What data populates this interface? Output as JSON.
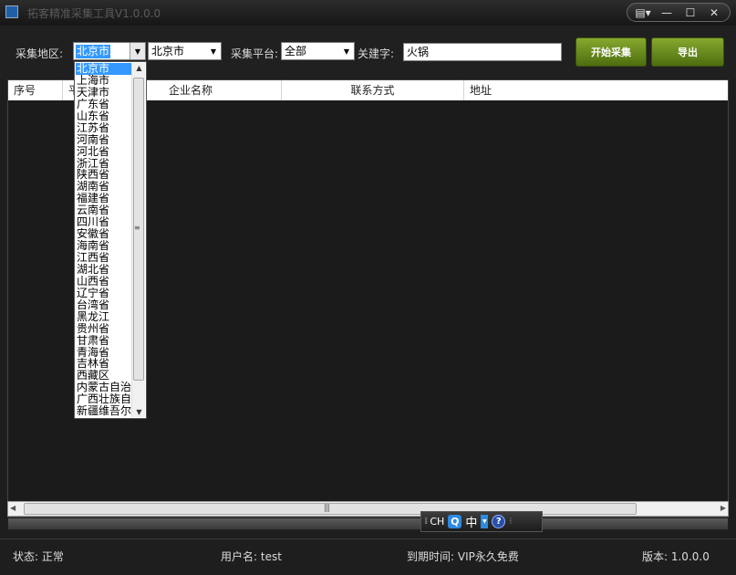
{
  "window": {
    "title": "拓客精准采集工具V1.0.0.0",
    "menu_icon": "menu-dropdown-icon",
    "min_icon": "minimize-icon",
    "max_icon": "maximize-icon",
    "close_icon": "close-icon"
  },
  "toolbar": {
    "region_label": "采集地区:",
    "province_value": "北京市",
    "city_value": "北京市",
    "platform_label": "采集平台:",
    "platform_value": "全部",
    "keyword_label": "关建字:",
    "keyword_value": "火锅",
    "start_button": "开始采集",
    "export_button": "导出"
  },
  "grid": {
    "columns": [
      "序号",
      "平",
      "企业名称",
      "联系方式",
      "地址"
    ]
  },
  "province_dropdown": {
    "selected_index": 0,
    "items": [
      "北京市",
      "上海市",
      "天津市",
      "广东省",
      "山东省",
      "江苏省",
      "河南省",
      "河北省",
      "浙江省",
      "陕西省",
      "湖南省",
      "福建省",
      "云南省",
      "四川省",
      "安徽省",
      "海南省",
      "江西省",
      "湖北省",
      "山西省",
      "辽宁省",
      "台湾省",
      "黑龙江",
      "贵州省",
      "甘肃省",
      "青海省",
      "吉林省",
      "西藏区",
      "内蒙古自治",
      "广西壮族自",
      "新疆维吾尔"
    ]
  },
  "ime": {
    "lang": "CH",
    "mode": "中",
    "help": "?"
  },
  "status": {
    "state": "状态: 正常",
    "user": "用户名: test",
    "expire": "到期时间: VIP永久免费",
    "version": "版本: 1.0.0.0"
  }
}
